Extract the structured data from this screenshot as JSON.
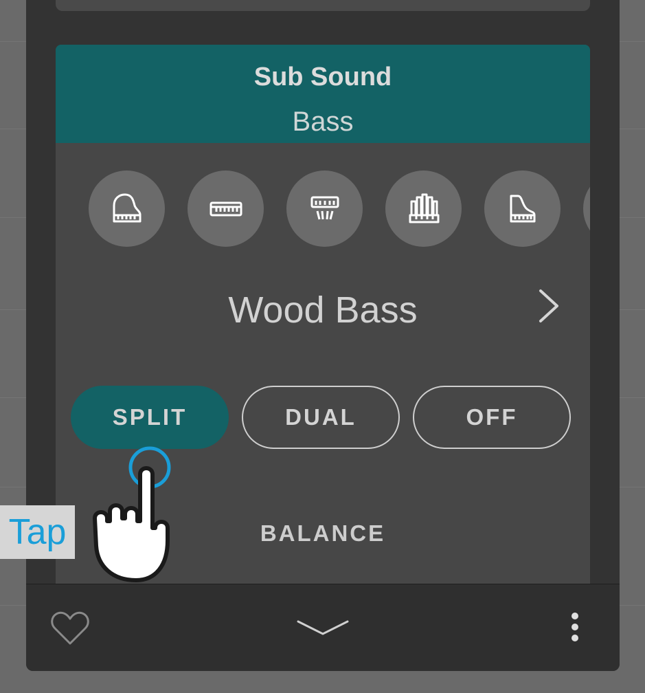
{
  "header": {
    "title": "Sub Sound",
    "subtitle": "Bass"
  },
  "categories": [
    {
      "icon": "grand-piano-icon"
    },
    {
      "icon": "keyboard-icon"
    },
    {
      "icon": "electric-piano-icon"
    },
    {
      "icon": "organ-icon"
    },
    {
      "icon": "upright-piano-icon"
    },
    {
      "icon": "more-category-icon"
    }
  ],
  "sound": {
    "name": "Wood Bass"
  },
  "modes": {
    "split": "SPLIT",
    "dual": "DUAL",
    "off": "OFF",
    "selected": "SPLIT"
  },
  "balance": {
    "label": "BALANCE"
  },
  "tutorial": {
    "tap_label": "Tap"
  },
  "colors": {
    "accent": "#136265",
    "panel": "#333333",
    "card": "#474747",
    "tap_blue": "#1a9ed8"
  }
}
